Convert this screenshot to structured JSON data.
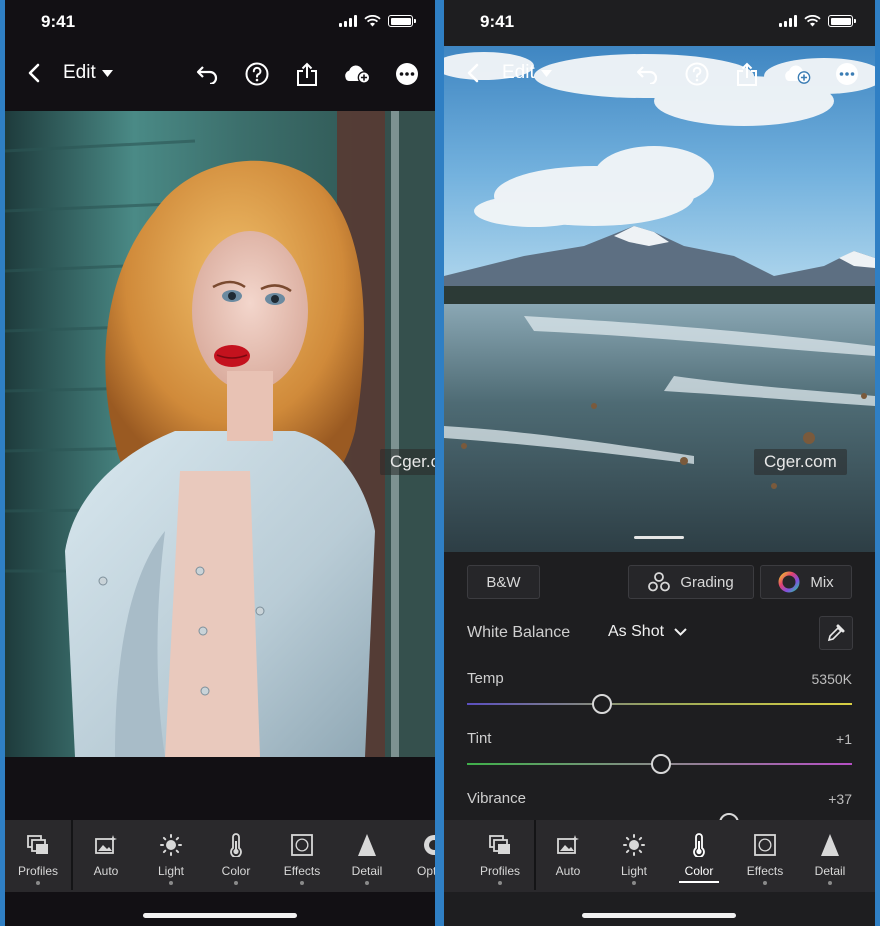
{
  "status": {
    "time": "9:41"
  },
  "top_bar": {
    "edit_label": "Edit"
  },
  "watermark": "Cger.com",
  "left_nav": {
    "items": [
      {
        "label": "Profiles",
        "icon": "profiles-icon"
      },
      {
        "label": "Auto",
        "icon": "auto-icon"
      },
      {
        "label": "Light",
        "icon": "sun-icon"
      },
      {
        "label": "Color",
        "icon": "thermometer-icon"
      },
      {
        "label": "Effects",
        "icon": "effects-icon"
      },
      {
        "label": "Detail",
        "icon": "detail-icon"
      },
      {
        "label": "Optics",
        "icon": "optics-icon"
      }
    ]
  },
  "right_nav": {
    "active": "Color",
    "items": [
      {
        "label": "Profiles",
        "icon": "profiles-icon"
      },
      {
        "label": "Auto",
        "icon": "auto-icon"
      },
      {
        "label": "Light",
        "icon": "sun-icon"
      },
      {
        "label": "Color",
        "icon": "thermometer-icon"
      },
      {
        "label": "Effects",
        "icon": "effects-icon"
      },
      {
        "label": "Detail",
        "icon": "detail-icon"
      }
    ]
  },
  "color_panel": {
    "bw_label": "B&W",
    "grading_label": "Grading",
    "mix_label": "Mix",
    "white_balance_label": "White Balance",
    "white_balance_value": "As Shot",
    "sliders": [
      {
        "label": "Temp",
        "value": "5350K",
        "position": 0.35
      },
      {
        "label": "Tint",
        "value": "+1",
        "position": 0.505
      },
      {
        "label": "Vibrance",
        "value": "+37",
        "position": 0.68
      }
    ]
  },
  "colors": {
    "accent": "#ffffff",
    "panel_bg": "#1e1e20",
    "nav_bg": "#2a292c",
    "temp_gradient": [
      "#5b4fc0",
      "#9aa85a",
      "#d8cf43"
    ],
    "tint_gradient": [
      "#3fb04a",
      "#8a8a8a",
      "#b54fc4"
    ]
  }
}
